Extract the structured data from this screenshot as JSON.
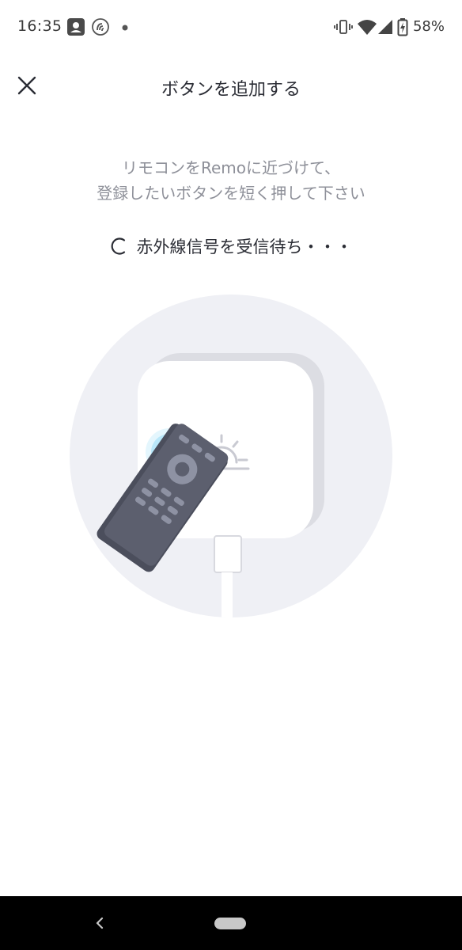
{
  "status_bar": {
    "time": "16:35",
    "battery_percent": "58%",
    "icons": [
      "notification-contact-icon",
      "nfc-icon",
      "dot-icon",
      "vibrate-icon",
      "wifi-icon",
      "signal-icon",
      "battery-charging-icon"
    ]
  },
  "app_bar": {
    "title": "ボタンを追加する",
    "close_icon": "close-icon"
  },
  "instruction": {
    "line1": "リモコンをRemoに近づけて、",
    "line2": "登録したいボタンを短く押して下さい"
  },
  "status": {
    "waiting_text": "赤外線信号を受信待ち・・・",
    "spinner_icon": "loading-spinner-icon"
  },
  "illustration": {
    "subject": "remote-pointing-at-remo-device",
    "colors": {
      "circle_bg": "#eff0f5",
      "remote": "#5c5f6e",
      "remote_buttons": "#8e92a3",
      "ir_signal": "#1fb1ef"
    }
  },
  "nav_bar": {
    "back_icon": "back-icon",
    "home_icon": "home-pill-icon"
  }
}
